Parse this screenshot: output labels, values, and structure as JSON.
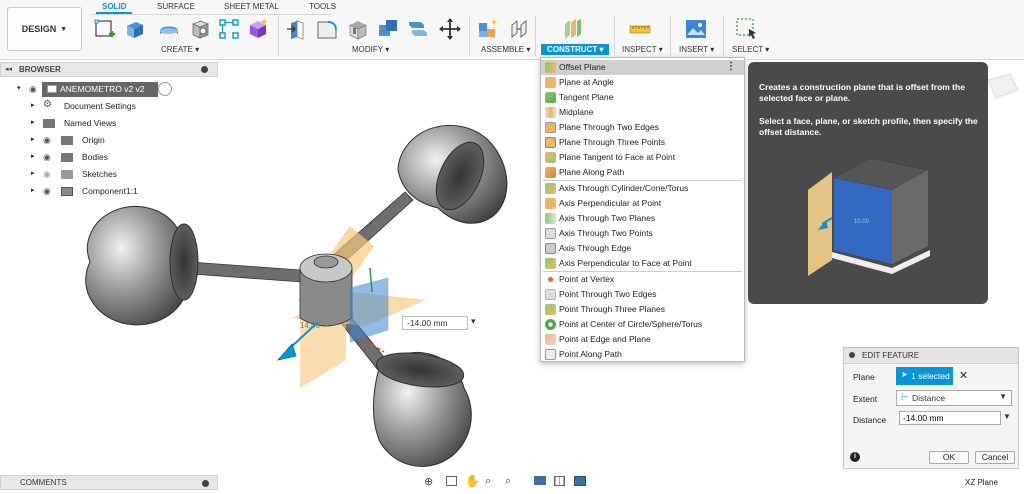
{
  "toolbar": {
    "workspace": "DESIGN",
    "tabs": [
      "SOLID",
      "SURFACE",
      "SHEET METAL",
      "TOOLS"
    ],
    "groups": {
      "create": "CREATE",
      "modify": "MODIFY",
      "assemble": "ASSEMBLE",
      "construct": "CONSTRUCT",
      "inspect": "INSPECT",
      "insert": "INSERT",
      "select": "SELECT"
    },
    "accent_color": "#0696d7"
  },
  "browser": {
    "title": "BROWSER",
    "root": "ANEMOMETRO v2 v2",
    "items": [
      "Document Settings",
      "Named Views",
      "Origin",
      "Bodies",
      "Sketches",
      "Component1:1"
    ]
  },
  "construct_menu": {
    "items": [
      "Offset Plane",
      "Plane at Angle",
      "Tangent Plane",
      "Midplane",
      "Plane Through Two Edges",
      "Plane Through Three Points",
      "Plane Tangent to Face at Point",
      "Plane Along Path",
      "Axis Through Cylinder/Cone/Torus",
      "Axis Perpendicular at Point",
      "Axis Through Two Planes",
      "Axis Through Two Points",
      "Axis Through Edge",
      "Axis Perpendicular to Face at Point",
      "Point at Vertex",
      "Point Through Two Edges",
      "Point Through Three Planes",
      "Point at Center of Circle/Sphere/Torus",
      "Point at Edge and Plane",
      "Point Along Path"
    ]
  },
  "tooltip": {
    "line1": "Creates a construction plane that is offset from the selected face or plane.",
    "line2": "Select a face, plane, or sketch profile, then specify the offset distance.",
    "image_label": "10.00"
  },
  "viewport": {
    "distance_input": "-14.00 mm",
    "dimension_label": "14.00"
  },
  "edit_feature": {
    "title": "EDIT FEATURE",
    "plane_label": "Plane",
    "plane_value": "1 selected",
    "extent_label": "Extent",
    "extent_value": "Distance",
    "distance_label": "Distance",
    "distance_value": "-14.00 mm",
    "ok": "OK",
    "cancel": "Cancel"
  },
  "comments": {
    "title": "COMMENTS"
  },
  "status": {
    "view": "XZ Plane"
  }
}
